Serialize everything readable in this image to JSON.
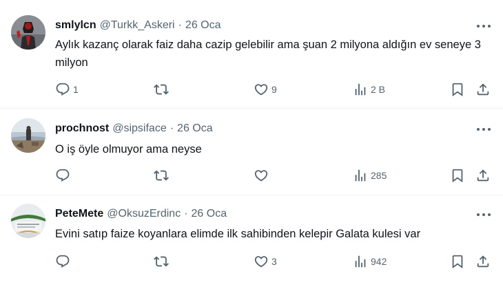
{
  "tweets": [
    {
      "name": "smlylcn",
      "handle": "@Turkk_Askeri",
      "separator": "·",
      "date": "26 Oca",
      "text": "Aylık kazanç olarak faiz daha cazip gelebilir ama şuan 2 milyona aldığın ev seneye 3 milyon",
      "replies": "1",
      "retweets": "",
      "likes": "9",
      "views": "2 B"
    },
    {
      "name": "prochnost",
      "handle": "@sipsiface",
      "separator": "·",
      "date": "26 Oca",
      "text": "O iş öyle olmuyor ama neyse",
      "replies": "",
      "retweets": "",
      "likes": "",
      "views": "285"
    },
    {
      "name": "PeteMete",
      "handle": "@OksuzErdinc",
      "separator": "·",
      "date": "26 Oca",
      "text": "Evini satıp faize koyanlara elimde ilk sahibinden kelepir Galata kulesi var",
      "replies": "",
      "retweets": "",
      "likes": "3",
      "views": "942"
    }
  ],
  "colors": {
    "text_primary": "#0f1419",
    "text_secondary": "#536471",
    "divider": "#eff3f4"
  },
  "icons": [
    "more-icon",
    "reply-icon",
    "retweet-icon",
    "like-icon",
    "views-icon",
    "bookmark-icon",
    "share-icon"
  ]
}
